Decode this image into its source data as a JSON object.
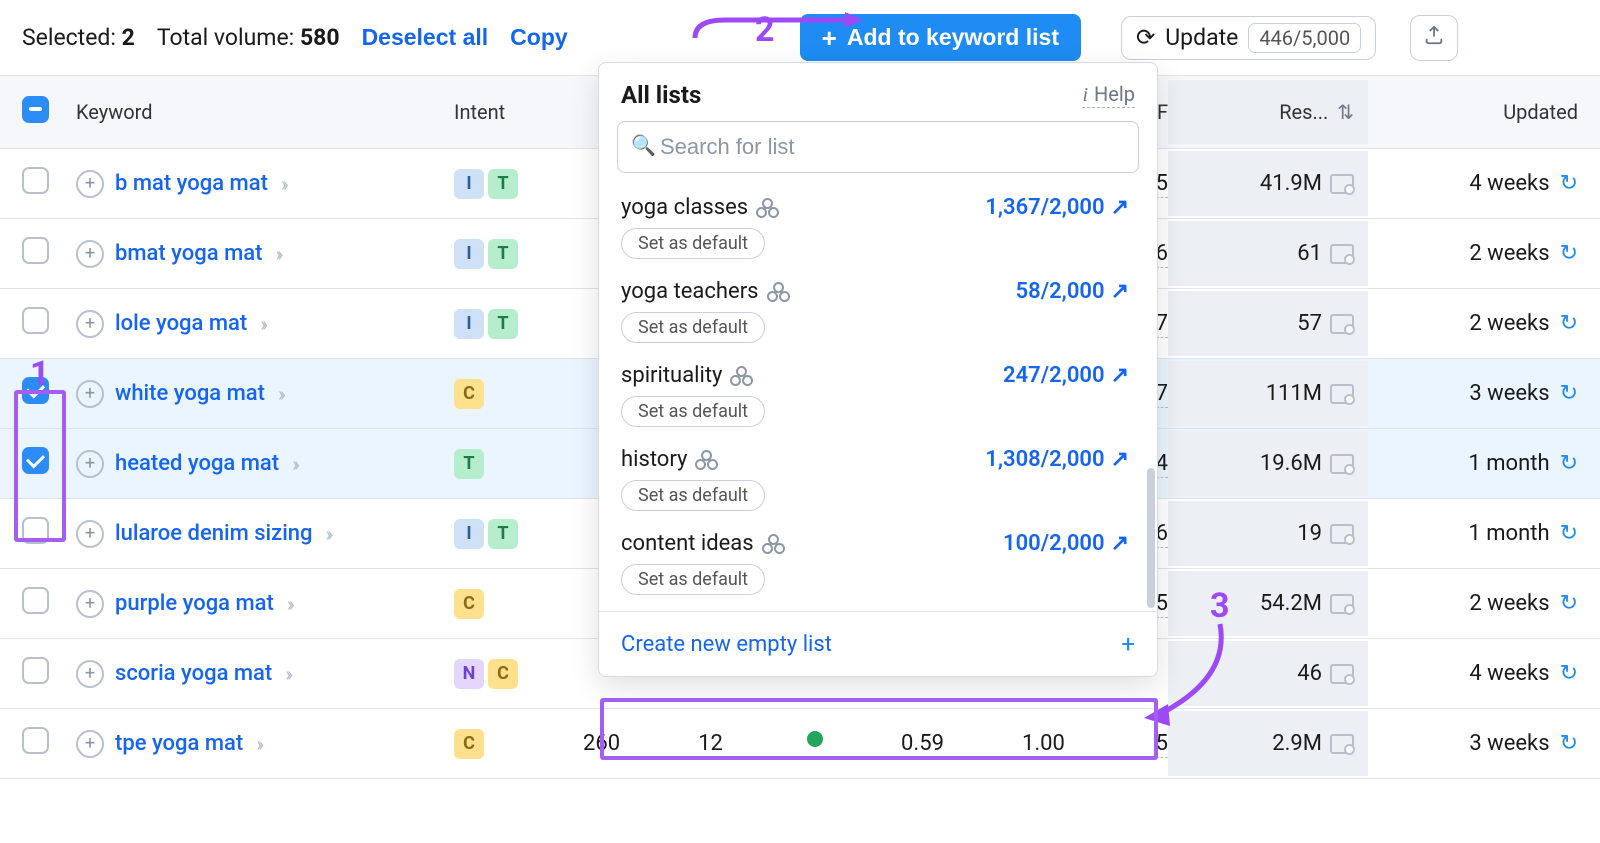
{
  "topbar": {
    "selected_label": "Selected:",
    "selected_count": "2",
    "total_label": "Total volume:",
    "total_value": "580",
    "deselect": "Deselect all",
    "copy": "Copy",
    "add_button": "Add to keyword list",
    "update_label": "Update",
    "update_count": "446/5,000"
  },
  "columns": {
    "keyword": "Keyword",
    "intent": "Intent",
    "sf": "SF",
    "results": "Res...",
    "updated": "Updated"
  },
  "rows": [
    {
      "keyword": "b mat yoga mat",
      "intent": [
        "I",
        "T"
      ],
      "sf": "5",
      "results": "41.9M",
      "updated": "4 weeks",
      "selected": false
    },
    {
      "keyword": "bmat yoga mat",
      "intent": [
        "I",
        "T"
      ],
      "sf": "6",
      "results": "61",
      "updated": "2 weeks",
      "selected": false
    },
    {
      "keyword": "lole yoga mat",
      "intent": [
        "I",
        "T"
      ],
      "sf": "7",
      "results": "57",
      "updated": "2 weeks",
      "selected": false
    },
    {
      "keyword": "white yoga mat",
      "intent": [
        "C"
      ],
      "sf": "7",
      "results": "111M",
      "updated": "3 weeks",
      "selected": true
    },
    {
      "keyword": "heated yoga mat",
      "intent": [
        "T"
      ],
      "sf": "4",
      "results": "19.6M",
      "updated": "1 month",
      "selected": true
    },
    {
      "keyword": "lularoe denim sizing",
      "intent": [
        "I",
        "T"
      ],
      "sf": "6",
      "results": "19",
      "updated": "1 month",
      "selected": false
    },
    {
      "keyword": "purple yoga mat",
      "intent": [
        "C"
      ],
      "sf": "5",
      "results": "54.2M",
      "updated": "2 weeks",
      "selected": false
    },
    {
      "keyword": "scoria yoga mat",
      "intent": [
        "N",
        "C"
      ],
      "sf": "",
      "results": "46",
      "updated": "4 weeks",
      "selected": false
    },
    {
      "keyword": "tpe yoga mat",
      "intent": [
        "C"
      ],
      "sf": "5",
      "results": "2.9M",
      "updated": "3 weeks",
      "selected": false
    }
  ],
  "bottom_extra": {
    "volume": "260",
    "kd": "12",
    "cpc": "0.59",
    "com": "1.00"
  },
  "popover": {
    "title": "All lists",
    "help": "Help",
    "search_placeholder": "Search for list",
    "set_default": "Set as default",
    "create": "Create new empty list",
    "items": [
      {
        "name": "yoga classes",
        "count": "1,367/2,000"
      },
      {
        "name": "yoga teachers",
        "count": "58/2,000"
      },
      {
        "name": "spirituality",
        "count": "247/2,000"
      },
      {
        "name": "history",
        "count": "1,308/2,000"
      },
      {
        "name": "content ideas",
        "count": "100/2,000"
      }
    ]
  },
  "annotations": {
    "n1": "1",
    "n2": "2",
    "n3": "3"
  }
}
